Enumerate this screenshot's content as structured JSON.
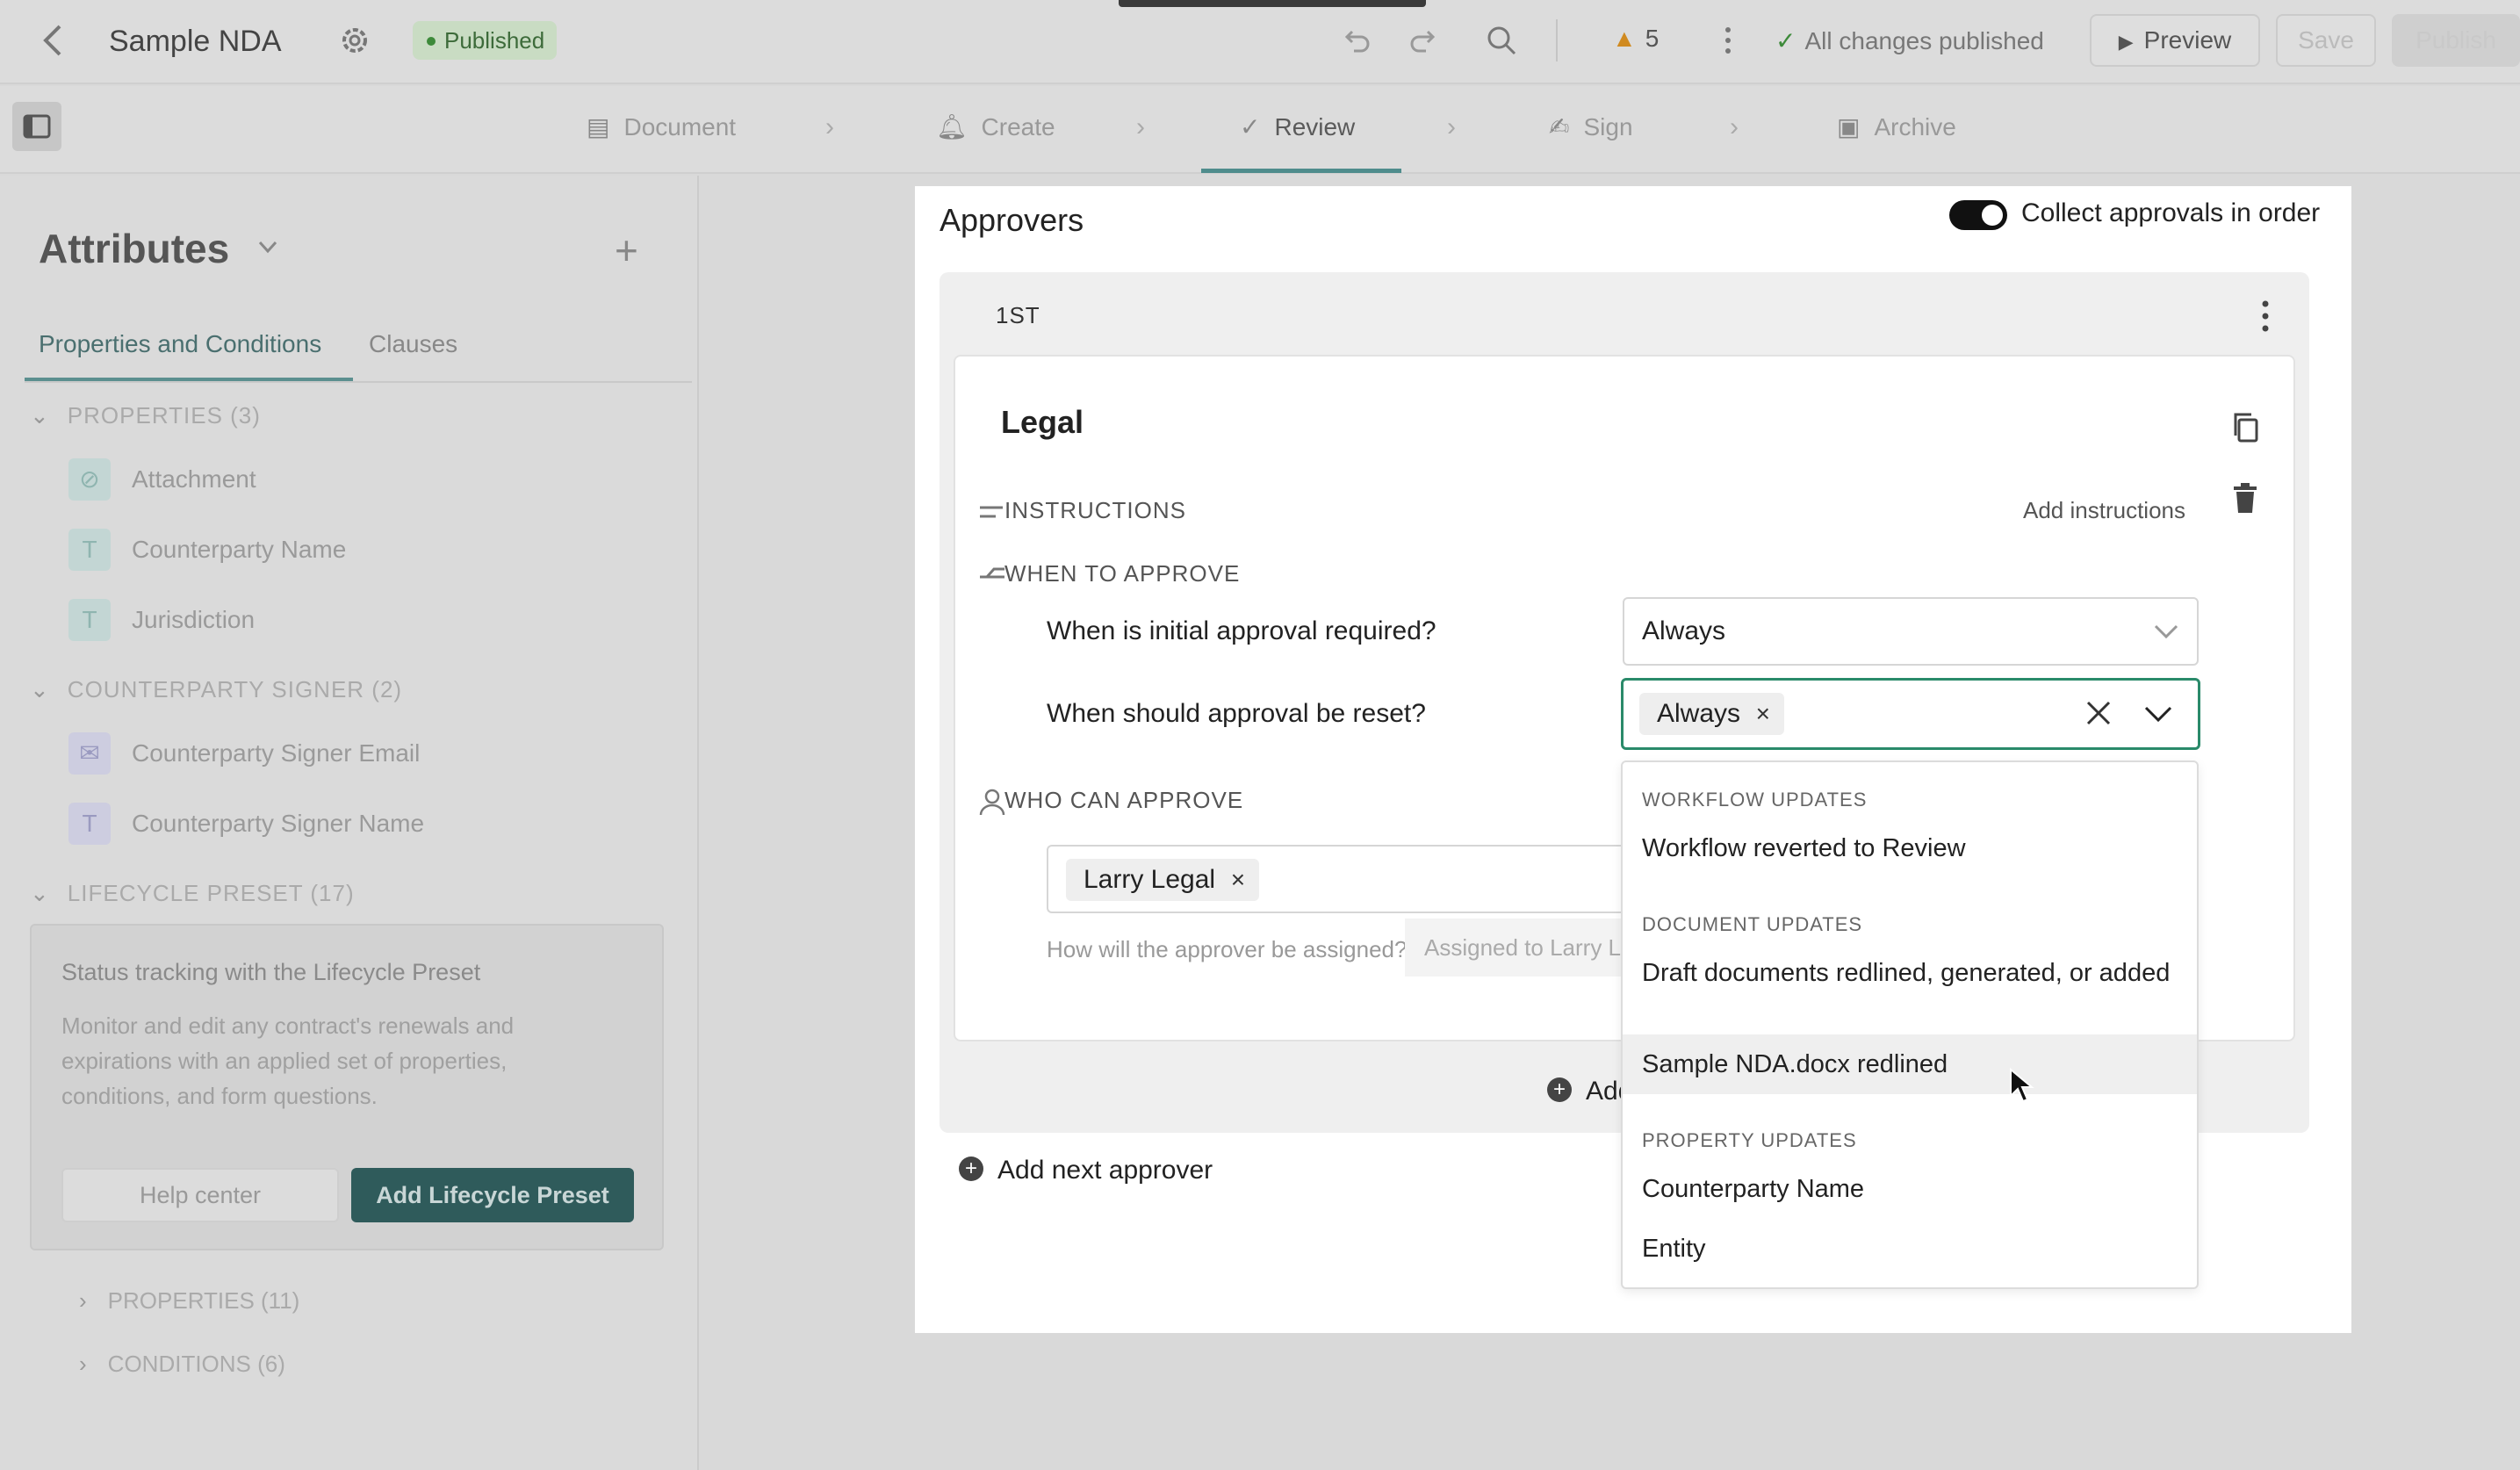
{
  "topbar": {
    "doc_title": "Sample NDA",
    "status_badge": "Published",
    "warnings_count": "5",
    "status_text": "All changes published",
    "preview_label": "Preview",
    "save_label": "Save",
    "publish_label": "Publish"
  },
  "steps": [
    {
      "label": "Document",
      "icon": "document-icon"
    },
    {
      "label": "Create",
      "icon": "bell-icon"
    },
    {
      "label": "Review",
      "icon": "check-icon"
    },
    {
      "label": "Sign",
      "icon": "signature-icon"
    },
    {
      "label": "Archive",
      "icon": "archive-icon"
    }
  ],
  "left_panel": {
    "title": "Attributes",
    "tabs": [
      "Properties and Conditions",
      "Clauses"
    ],
    "sections": [
      {
        "title": "PROPERTIES (3)",
        "items": [
          {
            "label": "Attachment",
            "icon": "paperclip-icon"
          },
          {
            "label": "Counterparty Name",
            "icon": "text-icon"
          },
          {
            "label": "Jurisdiction",
            "icon": "text-icon"
          }
        ]
      },
      {
        "title": "COUNTERPARTY SIGNER (2)",
        "items": [
          {
            "label": "Counterparty Signer Email",
            "icon": "email-icon"
          },
          {
            "label": "Counterparty Signer Name",
            "icon": "text-icon"
          }
        ]
      },
      {
        "title": "LIFECYCLE PRESET (17)"
      }
    ],
    "promo": {
      "title": "Status tracking with the Lifecycle Preset",
      "text": "Monitor and edit any contract's renewals and expirations with an applied set of properties, conditions, and form questions.",
      "help_label": "Help center",
      "add_label": "Add Lifecycle Preset"
    },
    "collapsed": [
      "PROPERTIES (11)",
      "CONDITIONS (6)"
    ]
  },
  "approvers": {
    "title": "Approvers",
    "toggle_label": "Collect approvals in order",
    "toggle_on": true,
    "group_order": "1ST",
    "card": {
      "title": "Legal",
      "instructions_label": "INSTRUCTIONS",
      "add_instructions": "Add instructions",
      "when_label": "WHEN TO APPROVE",
      "q_initial": "When is initial approval required?",
      "initial_value": "Always",
      "q_reset": "When should approval be reset?",
      "reset_chip": "Always",
      "who_label": "WHO CAN APPROVE",
      "approver_chip": "Larry Legal",
      "assign_question": "How will the approver be assigned?",
      "assign_value": "Assigned to Larry L"
    },
    "add_condition": "Add a",
    "add_next": "Add next approver"
  },
  "dropdown": {
    "groups": [
      {
        "title": "WORKFLOW UPDATES",
        "items": [
          "Workflow reverted to Review"
        ]
      },
      {
        "title": "DOCUMENT UPDATES",
        "items": [
          "Draft documents redlined, generated, or added",
          "Sample NDA.docx redlined"
        ]
      },
      {
        "title": "PROPERTY UPDATES",
        "items": [
          "Counterparty Name",
          "Entity"
        ]
      }
    ],
    "hovered_item": "Sample NDA.docx redlined"
  },
  "colors": {
    "accent": "#2a8a6a",
    "primary_button": "#2f5b5b"
  }
}
